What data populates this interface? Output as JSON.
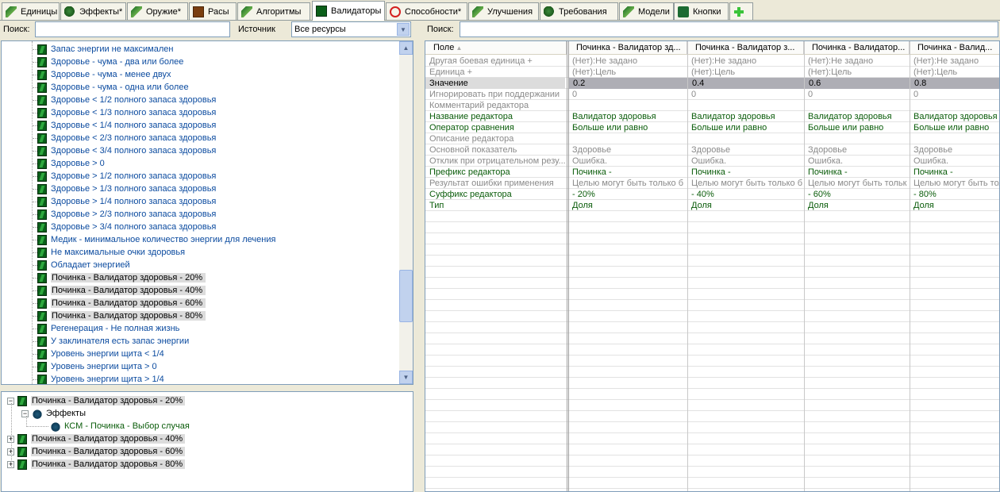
{
  "tabs": [
    {
      "label": "Единицы",
      "icon": "unit-icon"
    },
    {
      "label": "Эффекты*",
      "icon": "effects-icon"
    },
    {
      "label": "Оружие*",
      "icon": "weapon-icon"
    },
    {
      "label": "Расы",
      "icon": "races-icon"
    },
    {
      "label": "Алгоритмы",
      "icon": "algorithms-icon"
    },
    {
      "label": "Валидаторы",
      "icon": "validators-icon"
    },
    {
      "label": "Способности*",
      "icon": "abilities-icon"
    },
    {
      "label": "Улучшения",
      "icon": "upgrades-icon"
    },
    {
      "label": "Требования",
      "icon": "requirements-icon"
    },
    {
      "label": "Модели",
      "icon": "models-icon"
    },
    {
      "label": "Кнопки",
      "icon": "buttons-icon"
    }
  ],
  "left_toolbar": {
    "search_label": "Поиск:",
    "search_value": "",
    "source_label": "Источник",
    "source_value": "Все ресурсы"
  },
  "right_toolbar": {
    "search_label": "Поиск:",
    "search_value": ""
  },
  "tree_items": [
    "Запас энергии не максимален",
    "Здоровье - чума - два или более",
    "Здоровье - чума - менее двух",
    "Здоровье - чума - одна или более",
    "Здоровье < 1/2 полного запаса здоровья",
    "Здоровье < 1/3 полного запаса здоровья",
    "Здоровье < 1/4 полного запаса здоровья",
    "Здоровье < 2/3 полного запаса здоровья",
    "Здоровье < 3/4 полного запаса здоровья",
    "Здоровье > 0",
    "Здоровье > 1/2 полного запаса здоровья",
    "Здоровье > 1/3 полного запаса здоровья",
    "Здоровье > 1/4 полного запаса здоровья",
    "Здоровье > 2/3 полного запаса здоровья",
    "Здоровье > 3/4 полного запаса здоровья",
    "Медик - минимальное количество энергии для лечения",
    "Не максимальные очки здоровья",
    "Обладает энергией",
    "Починка - Валидатор здоровья - 20%",
    "Починка - Валидатор здоровья - 40%",
    "Починка - Валидатор здоровья - 60%",
    "Починка - Валидатор здоровья - 80%",
    "Регенерация - Не полная жизнь",
    "У заклинателя есть запас энергии",
    "Уровень энергии щита < 1/4",
    "Уровень энергии щита > 0",
    "Уровень энергии щита > 1/4"
  ],
  "deps_tree": {
    "root": "Починка - Валидатор здоровья - 20%",
    "group": "Эффекты",
    "effect": "КСМ - Починка - Выбор случая",
    "siblings": [
      "Починка - Валидатор здоровья - 40%",
      "Починка - Валидатор здоровья - 60%",
      "Починка - Валидатор здоровья - 80%"
    ],
    "expand_minus": "−",
    "expand_plus": "+"
  },
  "grid": {
    "field_header": "Поле",
    "columns": [
      "Починка - Валидатор зд...",
      "Починка - Валидатор з...",
      "Починка - Валидатор...",
      "Починка - Валид..."
    ],
    "rows": [
      {
        "field": "Другая боевая единица +",
        "style": "gray",
        "values": [
          "(Нет):Не задано",
          "(Нет):Не задано",
          "(Нет):Не задано",
          "(Нет):Не задано"
        ]
      },
      {
        "field": "Единица +",
        "style": "gray",
        "values": [
          "(Нет):Цель",
          "(Нет):Цель",
          "(Нет):Цель",
          "(Нет):Цель"
        ]
      },
      {
        "field": "Значение",
        "style": "selected",
        "values": [
          "0.2",
          "0.4",
          "0.6",
          "0.8"
        ]
      },
      {
        "field": "Игнорировать при поддержании",
        "style": "gray",
        "values": [
          "0",
          "0",
          "0",
          "0"
        ]
      },
      {
        "field": "Комментарий редактора",
        "style": "gray",
        "values": [
          "",
          "",
          "",
          ""
        ]
      },
      {
        "field": "Название редактора",
        "style": "green",
        "values": [
          "Валидатор здоровья",
          "Валидатор здоровья",
          "Валидатор здоровья",
          "Валидатор здоровья"
        ]
      },
      {
        "field": "Оператор сравнения",
        "style": "green",
        "values": [
          "Больше или равно",
          "Больше или равно",
          "Больше или равно",
          "Больше или равно"
        ]
      },
      {
        "field": "Описание редактора",
        "style": "gray",
        "values": [
          "",
          "",
          "",
          ""
        ]
      },
      {
        "field": "Основной показатель",
        "style": "gray",
        "values": [
          "Здоровье",
          "Здоровье",
          "Здоровье",
          "Здоровье"
        ]
      },
      {
        "field": "Отклик при отрицательном резу...",
        "style": "gray",
        "values": [
          "Ошибка.",
          "Ошибка.",
          "Ошибка.",
          "Ошибка."
        ]
      },
      {
        "field": "Префикс редактора",
        "style": "green",
        "values": [
          "Починка -",
          "Починка -",
          "Починка -",
          "Починка -"
        ]
      },
      {
        "field": "Результат ошибки применения",
        "style": "gray",
        "values": [
          "Целью могут быть только б",
          "Целью могут быть только б",
          "Целью могут быть тольк",
          "Целью могут быть только те"
        ]
      },
      {
        "field": "Суффикс редактора",
        "style": "green",
        "values": [
          "- 20%",
          "- 40%",
          "- 60%",
          "- 80%"
        ]
      },
      {
        "field": "Тип",
        "style": "green",
        "values": [
          "Доля",
          "Доля",
          "Доля",
          "Доля"
        ]
      }
    ]
  }
}
